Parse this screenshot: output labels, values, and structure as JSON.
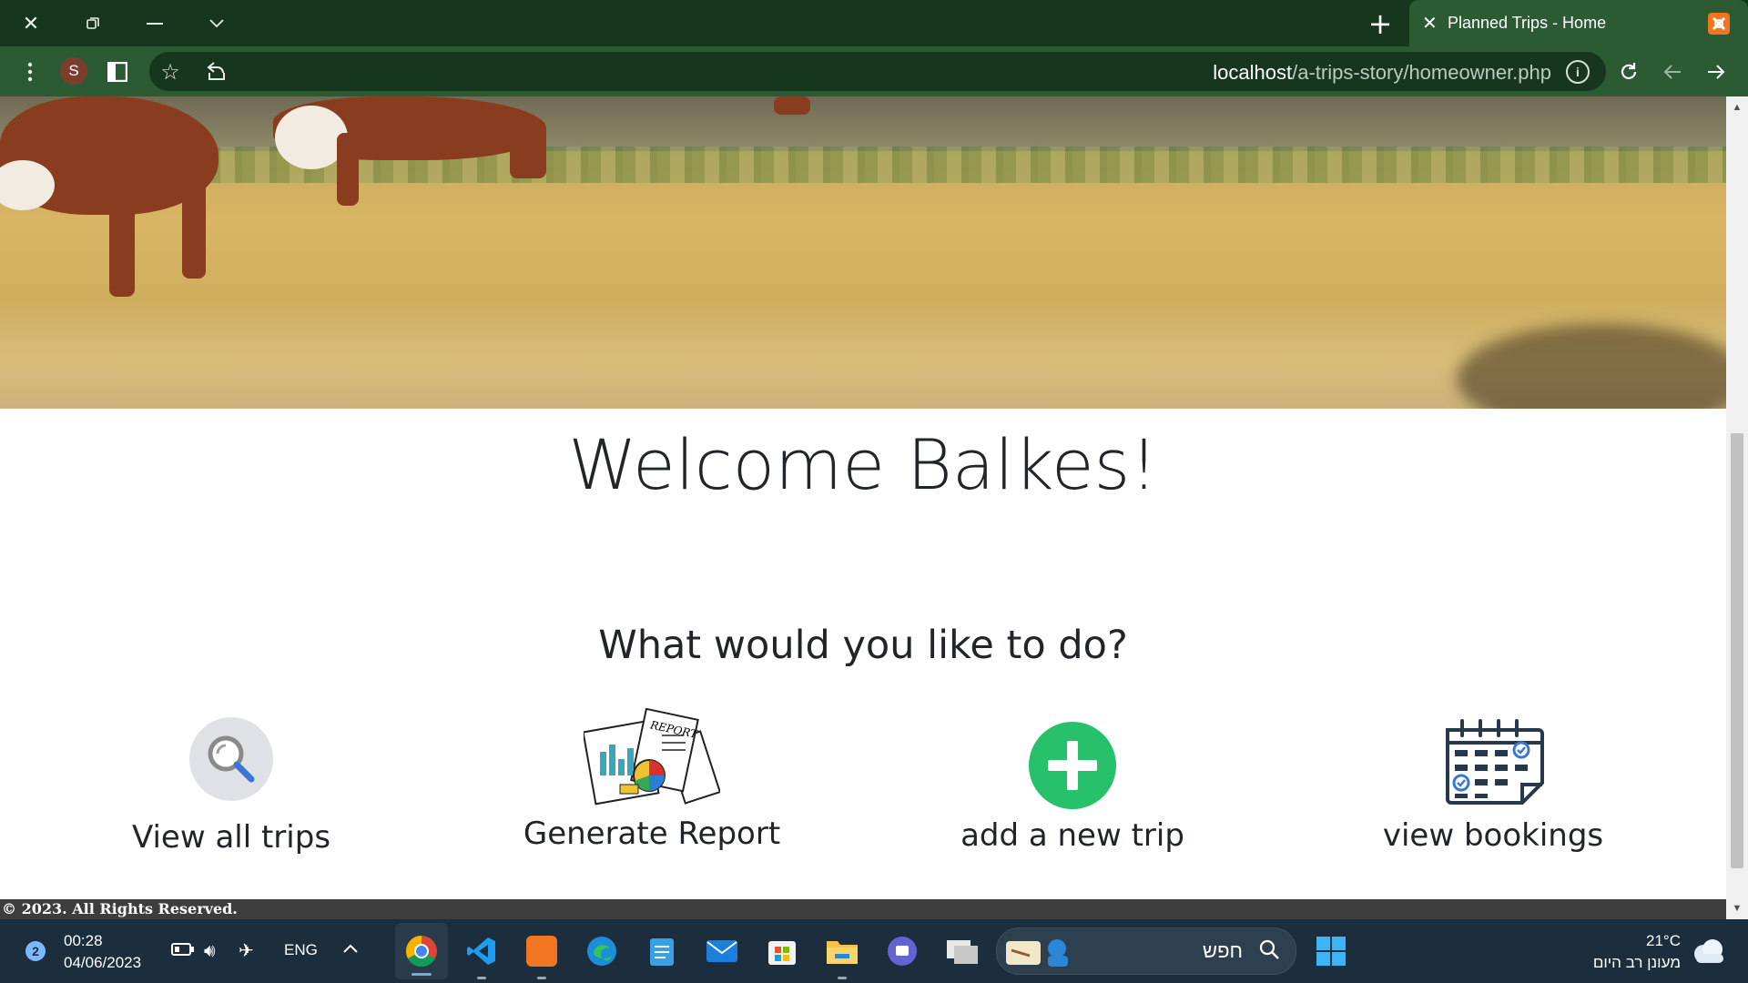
{
  "browser": {
    "tab_title": "Planned Trips - Home",
    "new_tab": "+",
    "tab_close": "✕",
    "profile_initial": "S",
    "url_host": "localhost",
    "url_path": "/a-trips-story/homeowner.php"
  },
  "page": {
    "welcome": "Welcome Balkes!",
    "question": "What would you like to do?",
    "actions": [
      {
        "label": "View all trips",
        "icon": "search-icon"
      },
      {
        "label": "Generate Report",
        "icon": "report-icon"
      },
      {
        "label": "add a new trip",
        "icon": "plus-circle-icon"
      },
      {
        "label": "view bookings",
        "icon": "calendar-icon"
      }
    ],
    "footer": "© 2023. All Rights Reserved."
  },
  "taskbar": {
    "notification_count": "2",
    "time": "00:28",
    "date": "04/06/2023",
    "language": "ENG",
    "search_text": "חפש",
    "temperature": "21°C",
    "weather_text": "מעונן רב היום"
  },
  "colors": {
    "titlebar": "#16371e",
    "addressbar": "#2b5a33",
    "add_trip_green": "#27c06b",
    "taskbar": "#1c2d3e"
  }
}
